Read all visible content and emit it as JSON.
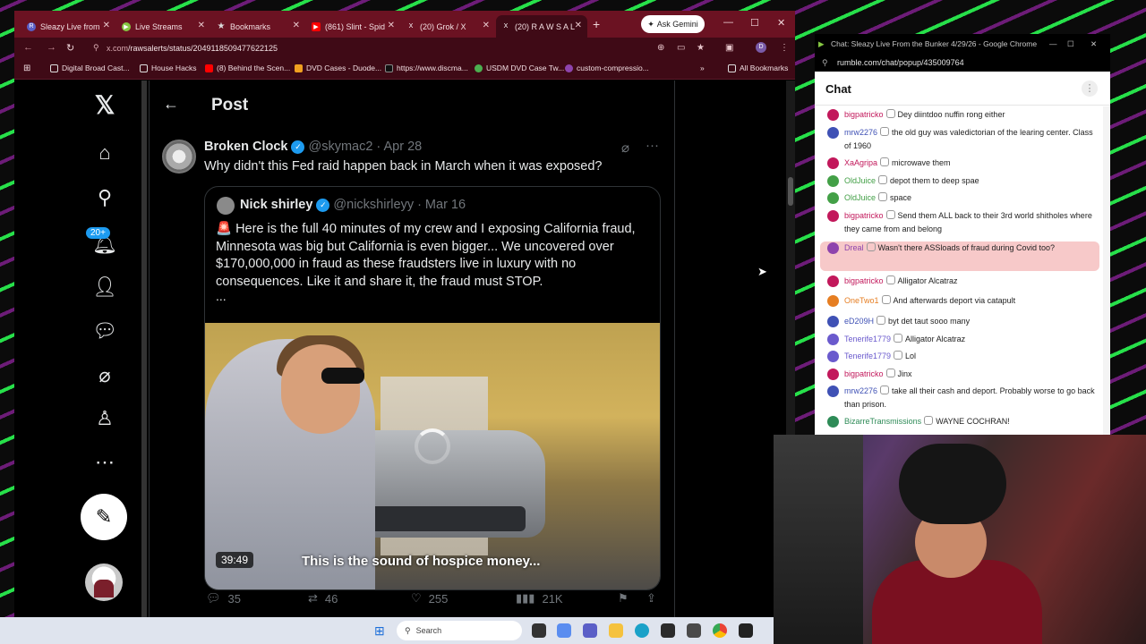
{
  "browser": {
    "tabs": [
      {
        "label": "Sleazy Live from",
        "color": "#5b5fc7",
        "letter": "R"
      },
      {
        "label": "Live Streams",
        "color": "#85c742",
        "letter": "▶"
      },
      {
        "label": "Bookmarks",
        "color": "#cccccc",
        "letter": "★"
      },
      {
        "label": "(861) Slint - Spid",
        "color": "#ff0000",
        "letter": "▶"
      },
      {
        "label": "(20) Grok / X",
        "color": "#000000",
        "letter": "X"
      },
      {
        "label": "(20) R A W S A L",
        "color": "#000000",
        "letter": "X"
      }
    ],
    "ask_gemini": "Ask Gemini",
    "url_site": "x.com",
    "url_path": "/rawsalerts/status/2049118509477622125",
    "bookmarks": [
      "Digital Broad Cast...",
      "House Hacks",
      "(8) Behind the Scen...",
      "DVD Cases - Duode...",
      "https://www.discma...",
      "USDM DVD Case Tw...",
      "custom-compressio..."
    ],
    "all_bookmarks": "All Bookmarks"
  },
  "x": {
    "page_title": "Post",
    "notifications_badge": "20+",
    "post": {
      "name": "Broken Clock",
      "handle": "@skymac2",
      "date": "· Apr 28",
      "text": "Why didn't this Fed raid happen back in March when it was exposed?"
    },
    "quote": {
      "name": "Nick shirley",
      "handle": "@nickshirleyy",
      "date": "· Mar 16",
      "text": "🚨 Here is the full 40 minutes of my crew and I exposing California fraud, Minnesota was big but California is even bigger... We uncovered over $170,000,000 in fraud as these fraudsters live in luxury with no consequences. Like it and share it, the fraud must STOP.",
      "more": "...",
      "video_duration": "39:49",
      "video_caption": "This is the sound of hospice money..."
    },
    "actions": {
      "replies": "35",
      "reposts": "46",
      "likes": "255",
      "views": "21K"
    }
  },
  "chat": {
    "window_title": "Chat: Sleazy Live From the Bunker 4/29/26 - Google Chrome",
    "url": "rumble.com/chat/popup/435009764",
    "header": "Chat",
    "messages": [
      {
        "user": "bigpatricko",
        "text": "Dey diintdoo nuffin rong either",
        "color": "#c2185b"
      },
      {
        "user": "mrw2276",
        "text": "the old guy was valedictorian of the learing center. Class of 1960",
        "color": "#3f51b5"
      },
      {
        "user": "XaAgripa",
        "text": "microwave them",
        "color": "#c2185b"
      },
      {
        "user": "OldJuice",
        "text": "depot them to deep spae",
        "color": "#43a047"
      },
      {
        "user": "OldJuice",
        "text": "space",
        "color": "#43a047"
      },
      {
        "user": "bigpatricko",
        "text": "Send them ALL back to their 3rd world shitholes where they came from and belong",
        "color": "#c2185b"
      },
      {
        "user": "Dreal",
        "text": "Wasn't there ASSloads of fraud during Covid too?",
        "color": "#8e44ad"
      },
      {
        "user": "bigpatricko",
        "text": "Alligator Alcatraz",
        "color": "#c2185b"
      },
      {
        "user": "OneTwo1",
        "text": "And afterwards deport via catapult",
        "color": "#e67e22"
      },
      {
        "user": "eD209H",
        "text": "byt det taut sooo many",
        "color": "#3f51b5"
      },
      {
        "user": "Tenerife1779",
        "text": "Alligator Alcatraz",
        "color": "#6a5acd"
      },
      {
        "user": "Tenerife1779",
        "text": "Lol",
        "color": "#6a5acd"
      },
      {
        "user": "bigpatricko",
        "text": "Jinx",
        "color": "#c2185b"
      },
      {
        "user": "mrw2276",
        "text": "take all their cash and deport. Probably worse to go back than prison.",
        "color": "#3f51b5"
      },
      {
        "user": "BizarreTransmissions",
        "text": "WAYNE COCHRAN!",
        "color": "#2e8b57"
      }
    ]
  },
  "taskbar": {
    "search": "Search"
  }
}
